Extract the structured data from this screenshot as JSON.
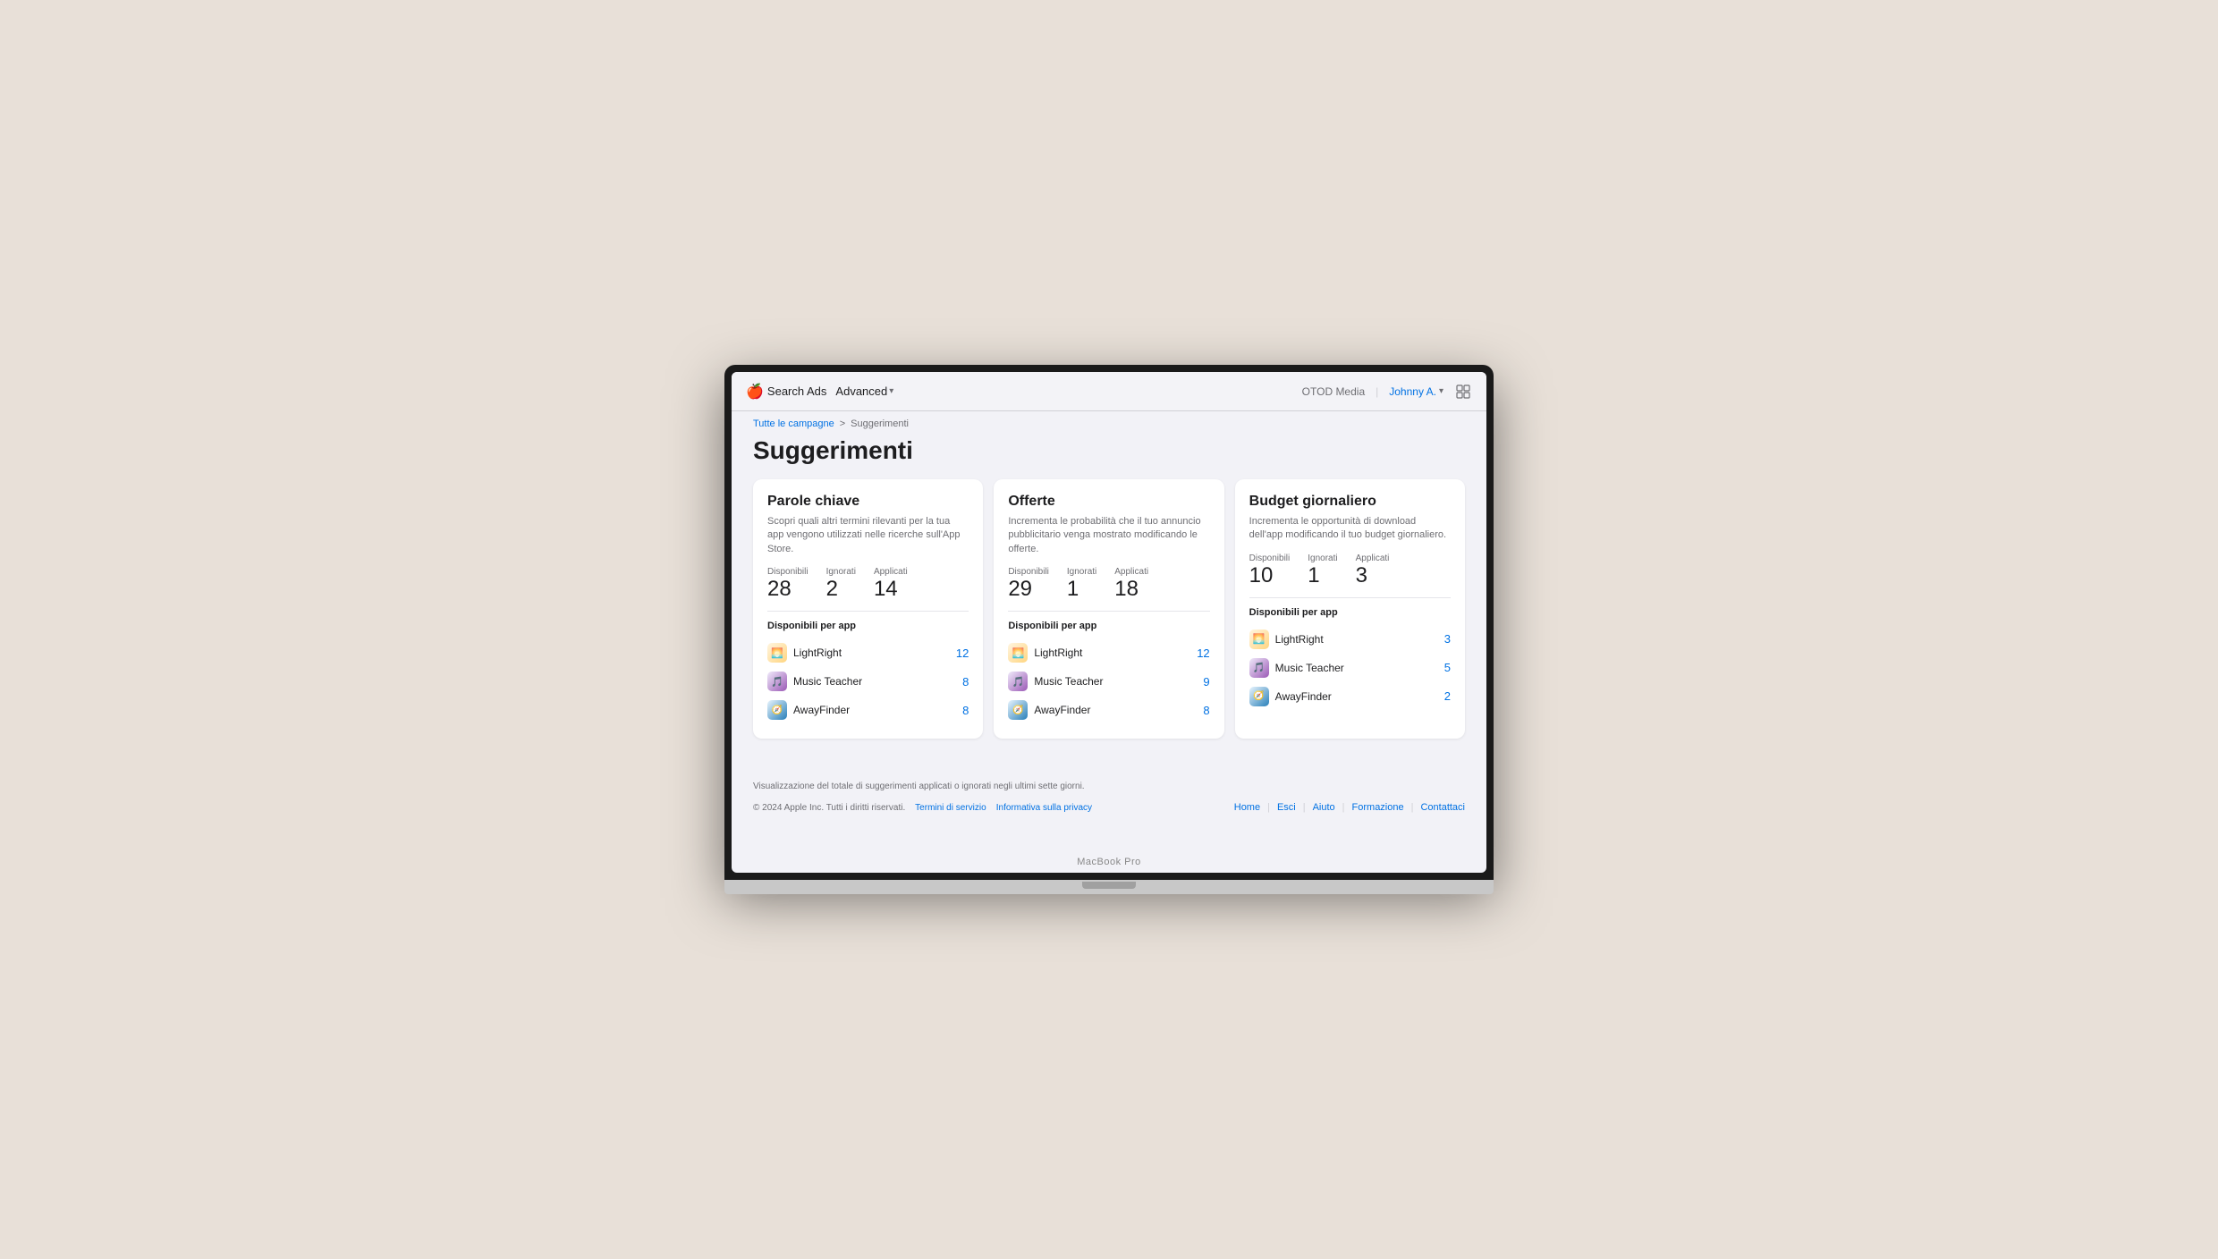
{
  "nav": {
    "apple_logo": "🍎",
    "search_ads_label": "Search Ads",
    "advanced_label": "Advanced",
    "org_name": "OTOD Media",
    "user_name": "Johnny A.",
    "layout_icon": "⊞"
  },
  "breadcrumb": {
    "campaigns_link": "Tutte le campagne",
    "separator": ">",
    "current": "Suggerimenti"
  },
  "page": {
    "title": "Suggerimenti"
  },
  "cards": [
    {
      "id": "keywords",
      "title": "Parole chiave",
      "description": "Scopri quali altri termini rilevanti per la tua app vengono utilizzati nelle ricerche sull'App Store.",
      "stats": {
        "available_label": "Disponibili",
        "available_value": "28",
        "ignored_label": "Ignorati",
        "ignored_value": "2",
        "applied_label": "Applicati",
        "applied_value": "14"
      },
      "apps_label": "Disponibili per app",
      "apps": [
        {
          "id": "lightright",
          "name": "LightRight",
          "count": "12",
          "icon": "🌅",
          "icon_type": "lightright"
        },
        {
          "id": "musicteacher",
          "name": "Music Teacher",
          "count": "8",
          "icon": "🎵",
          "icon_type": "musicteacher"
        },
        {
          "id": "awayfinder",
          "name": "AwayFinder",
          "count": "8",
          "icon": "🧭",
          "icon_type": "awayfinder"
        }
      ]
    },
    {
      "id": "offerte",
      "title": "Offerte",
      "description": "Incrementa le probabilità che il tuo annuncio pubblicitario venga mostrato modificando le offerte.",
      "stats": {
        "available_label": "Disponibili",
        "available_value": "29",
        "ignored_label": "Ignorati",
        "ignored_value": "1",
        "applied_label": "Applicati",
        "applied_value": "18"
      },
      "apps_label": "Disponibili per app",
      "apps": [
        {
          "id": "lightright",
          "name": "LightRight",
          "count": "12",
          "icon": "🌅",
          "icon_type": "lightright"
        },
        {
          "id": "musicteacher",
          "name": "Music Teacher",
          "count": "9",
          "icon": "🎵",
          "icon_type": "musicteacher"
        },
        {
          "id": "awayfinder",
          "name": "AwayFinder",
          "count": "8",
          "icon": "🧭",
          "icon_type": "awayfinder"
        }
      ]
    },
    {
      "id": "budget",
      "title": "Budget giornaliero",
      "description": "Incrementa le opportunità di download dell'app modificando il tuo budget giornaliero.",
      "stats": {
        "available_label": "Disponibili",
        "available_value": "10",
        "ignored_label": "Ignorati",
        "ignored_value": "1",
        "applied_label": "Applicati",
        "applied_value": "3"
      },
      "apps_label": "Disponibili per app",
      "apps": [
        {
          "id": "lightright",
          "name": "LightRight",
          "count": "3",
          "icon": "🌅",
          "icon_type": "lightright"
        },
        {
          "id": "musicteacher",
          "name": "Music Teacher",
          "count": "5",
          "icon": "🎵",
          "icon_type": "musicteacher"
        },
        {
          "id": "awayfinder",
          "name": "AwayFinder",
          "count": "2",
          "icon": "🧭",
          "icon_type": "awayfinder"
        }
      ]
    }
  ],
  "footer": {
    "note": "Visualizzazione del totale di suggerimenti applicati o ignorati negli ultimi sette giorni.",
    "copyright": "© 2024 Apple Inc. Tutti i diritti riservati.",
    "terms_link": "Termini di servizio",
    "privacy_link": "Informativa sulla privacy",
    "nav_links": [
      "Home",
      "Esci",
      "Aiuto",
      "Formazione",
      "Contattaci"
    ]
  }
}
